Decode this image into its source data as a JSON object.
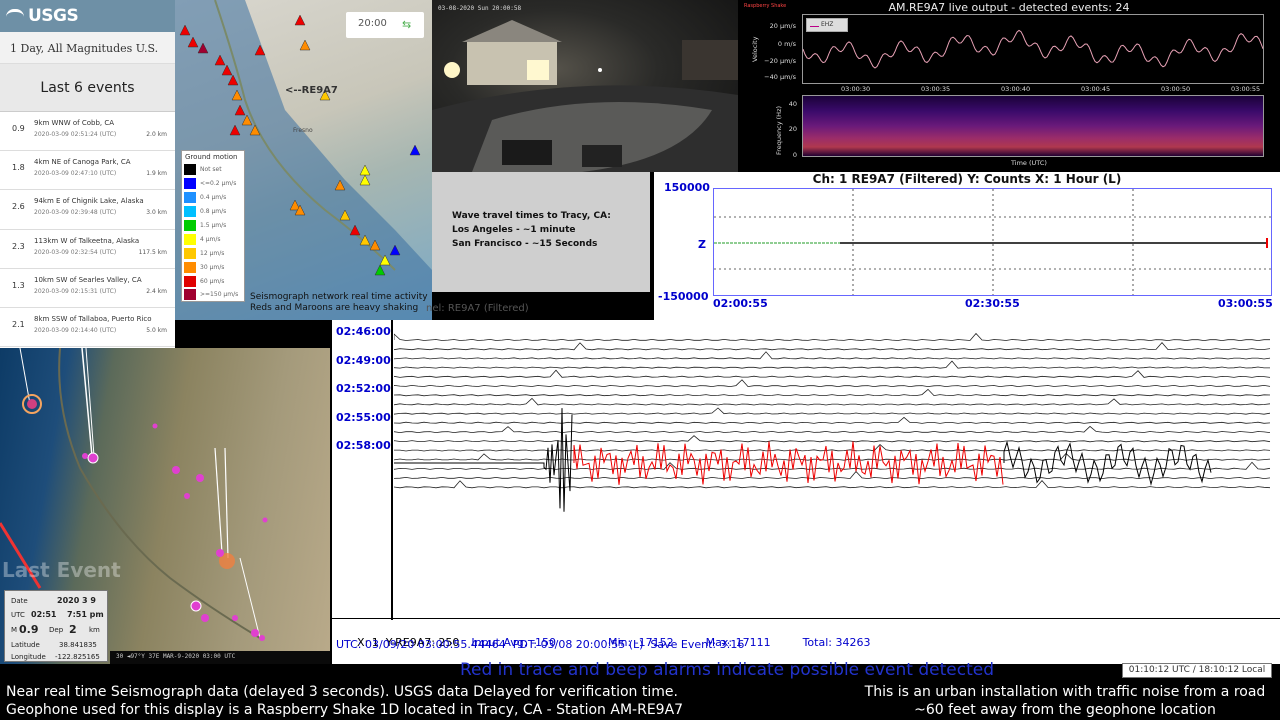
{
  "usgs": {
    "brand": "USGS",
    "feed": "1 Day, All Magnitudes U.S.",
    "last_events_label": "Last 6 events",
    "events": [
      {
        "mag": "0.9",
        "place": "9km WNW of Cobb, CA",
        "time": "2020-03-09 02:51:24 (UTC)",
        "depth": "2.0 km"
      },
      {
        "mag": "1.8",
        "place": "4km NE of Canoga Park, CA",
        "time": "2020-03-09 02:47:10 (UTC)",
        "depth": "1.9 km"
      },
      {
        "mag": "2.6",
        "place": "94km E of Chignik Lake, Alaska",
        "time": "2020-03-09 02:39:48 (UTC)",
        "depth": "3.0 km"
      },
      {
        "mag": "2.3",
        "place": "113km W of Talkeetna, Alaska",
        "time": "2020-03-09 02:32:54 (UTC)",
        "depth": "117.5 km"
      },
      {
        "mag": "1.3",
        "place": "10km SW of Searles Valley, CA",
        "time": "2020-03-09 02:15:31 (UTC)",
        "depth": "2.4 km"
      },
      {
        "mag": "2.1",
        "place": "8km SSW of Tallaboa, Puerto Rico",
        "time": "2020-03-09 02:14:40 (UTC)",
        "depth": "5.0 km"
      }
    ]
  },
  "map_top": {
    "time": "20:00",
    "station_label": "<--RE9A7",
    "city_label": "Fresno",
    "legend_title": "Ground motion",
    "legend": [
      {
        "label": "Not set",
        "color": "#000000"
      },
      {
        "label": "<=0.2 μm/s",
        "color": "#0000ff"
      },
      {
        "label": "0.4 μm/s",
        "color": "#1e90ff"
      },
      {
        "label": "0.8 μm/s",
        "color": "#00bfff"
      },
      {
        "label": "1.5 μm/s",
        "color": "#00cc00"
      },
      {
        "label": "4 μm/s",
        "color": "#ffff00"
      },
      {
        "label": "12 μm/s",
        "color": "#ffc800"
      },
      {
        "label": "30 μm/s",
        "color": "#ff8c00"
      },
      {
        "label": "60 μm/s",
        "color": "#e00000"
      },
      {
        "label": ">=150 μm/s",
        "color": "#a00030"
      }
    ],
    "caption_line1": "Seismograph network real time activity",
    "caption_line2": "Reds and Maroons are heavy shaking"
  },
  "camera": {
    "timestamp": "03-08-2020 Sun 20:00:58"
  },
  "rs": {
    "brand": "Raspberry Shake",
    "title": "AM.RE9A7 live output - detected events: 24",
    "legend": "EHZ",
    "velocity_label": "Velocity",
    "vel_ticks": [
      "20 μm/s",
      "0 m/s",
      "−20 μm/s",
      "−40 μm/s"
    ],
    "freq_label": "Frequency (Hz)",
    "freq_ticks": [
      "40",
      "20",
      "0"
    ],
    "time_ticks": [
      "03:00:30",
      "03:00:35",
      "03:00:40",
      "03:00:45",
      "03:00:50",
      "03:00:55"
    ],
    "xlabel": "Time (UTC)"
  },
  "wave": {
    "line1": "Wave travel times to Tracy, CA:",
    "line2": "Los Angeles - ~1 minute",
    "line3": "San Francisco - ~15 Seconds",
    "strip": "nel: RE9A7 (Filtered)"
  },
  "heli": {
    "title": "Ch: 1 RE9A7 (Filtered)  Y: Counts  X: 1 Hour (L)",
    "ymax": "150000",
    "ymid": "Z",
    "ymin": "-150000",
    "x_ticks": [
      "02:00:55",
      "02:30:55",
      "03:00:55"
    ]
  },
  "drum": {
    "times": [
      "02:46:00",
      "02:49:00",
      "02:52:00",
      "02:55:00",
      "02:58:00"
    ],
    "info1_parts": [
      "X: 1  Y-RE9A7: 250",
      "Input Avg: -150",
      "Min: -17152",
      "Max: 17111",
      "Total: 34263"
    ],
    "info2": "UTC: 03/09/20 03:00:55.44464  PDT: 03/08 20:00:55 (L)  Save Event: 3:16"
  },
  "map_bot": {
    "last_event": "Last Event",
    "bottom_strip": "30    ◄97°Y  37E  MAR-9-2020  03:00  UTC",
    "info": {
      "date_label": "Date",
      "date": "2020  3  9",
      "utc_label": "UTC",
      "utc": "02:51",
      "local": "7:51 pm",
      "m_label": "M",
      "mag": "0.9",
      "dep_label": "Dep",
      "dep": "2",
      "dep_unit": "km",
      "lat_label": "Latitude",
      "lat": "38.841835",
      "lon_label": "Longitude",
      "lon": "-122.825165"
    }
  },
  "footer": {
    "alarm": "Red in trace and beep alarms indicate possible event detected",
    "clock": "01:10:12 UTC / 18:10:12 Local",
    "left1": "Near real time Seismograph data (delayed 3 seconds). USGS data Delayed for verification time.",
    "left2": "Geophone used for this display is a Raspberry Shake 1D located in Tracy, CA - Station AM-RE9A7",
    "right1": "This is an urban installation with traffic noise from a road",
    "right2": "~60 feet away from the geophone location"
  }
}
